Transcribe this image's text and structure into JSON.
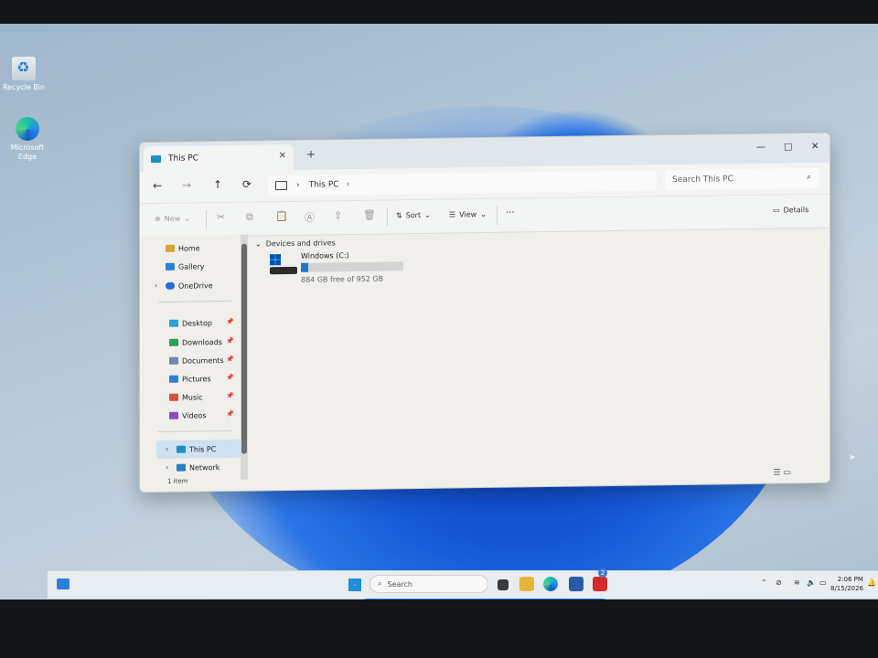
{
  "desktop": {
    "icons": [
      {
        "label": "Recycle Bin",
        "icon": "recycle-bin-icon"
      },
      {
        "label": "Microsoft Edge",
        "icon": "edge-icon"
      }
    ]
  },
  "window": {
    "tab_title": "This PC",
    "new_tab": "+",
    "controls": {
      "minimize": "—",
      "maximize": "□",
      "close": "✕"
    },
    "nav": {
      "back": "←",
      "forward": "→",
      "up": "↑",
      "refresh": "⟳"
    },
    "address": {
      "segment": "This PC",
      "separator": "›"
    },
    "search": {
      "placeholder": "Search This PC",
      "icon": "search-icon"
    },
    "toolbar": {
      "new_label": "New",
      "sort_label": "Sort",
      "view_label": "View",
      "more_label": "···",
      "details_label": "Details"
    },
    "sidebar": {
      "top": [
        {
          "label": "Home",
          "icon": "home-icon",
          "color": "#d6a23a"
        },
        {
          "label": "Gallery",
          "icon": "gallery-icon",
          "color": "#2f7ed8"
        },
        {
          "label": "OneDrive",
          "icon": "cloud-icon",
          "color": "#1f6fd0"
        }
      ],
      "pinned": [
        {
          "label": "Desktop",
          "icon": "desktop-folder-icon",
          "color": "#2aa0d8"
        },
        {
          "label": "Downloads",
          "icon": "downloads-folder-icon",
          "color": "#2f9f54"
        },
        {
          "label": "Documents",
          "icon": "documents-folder-icon",
          "color": "#6b8ba8"
        },
        {
          "label": "Pictures",
          "icon": "pictures-folder-icon",
          "color": "#2d7fd8"
        },
        {
          "label": "Music",
          "icon": "music-folder-icon",
          "color": "#d6503a"
        },
        {
          "label": "Videos",
          "icon": "videos-folder-icon",
          "color": "#8a4bc9"
        }
      ],
      "bottom": [
        {
          "label": "This PC",
          "icon": "this-pc-icon",
          "color": "#1f8fc4"
        },
        {
          "label": "Network",
          "icon": "network-icon",
          "color": "#2a7fbf"
        }
      ]
    },
    "content": {
      "group_label": "Devices and drives",
      "drives": [
        {
          "name": "Windows (C:)",
          "free_text": "884 GB free of 952 GB",
          "used_fraction": 0.071
        }
      ]
    },
    "status": {
      "count": "1 item"
    }
  },
  "taskbar": {
    "search_placeholder": "Search",
    "notification_count": "2",
    "clock_time": "2:06 PM",
    "clock_date": "8/15/2026"
  }
}
